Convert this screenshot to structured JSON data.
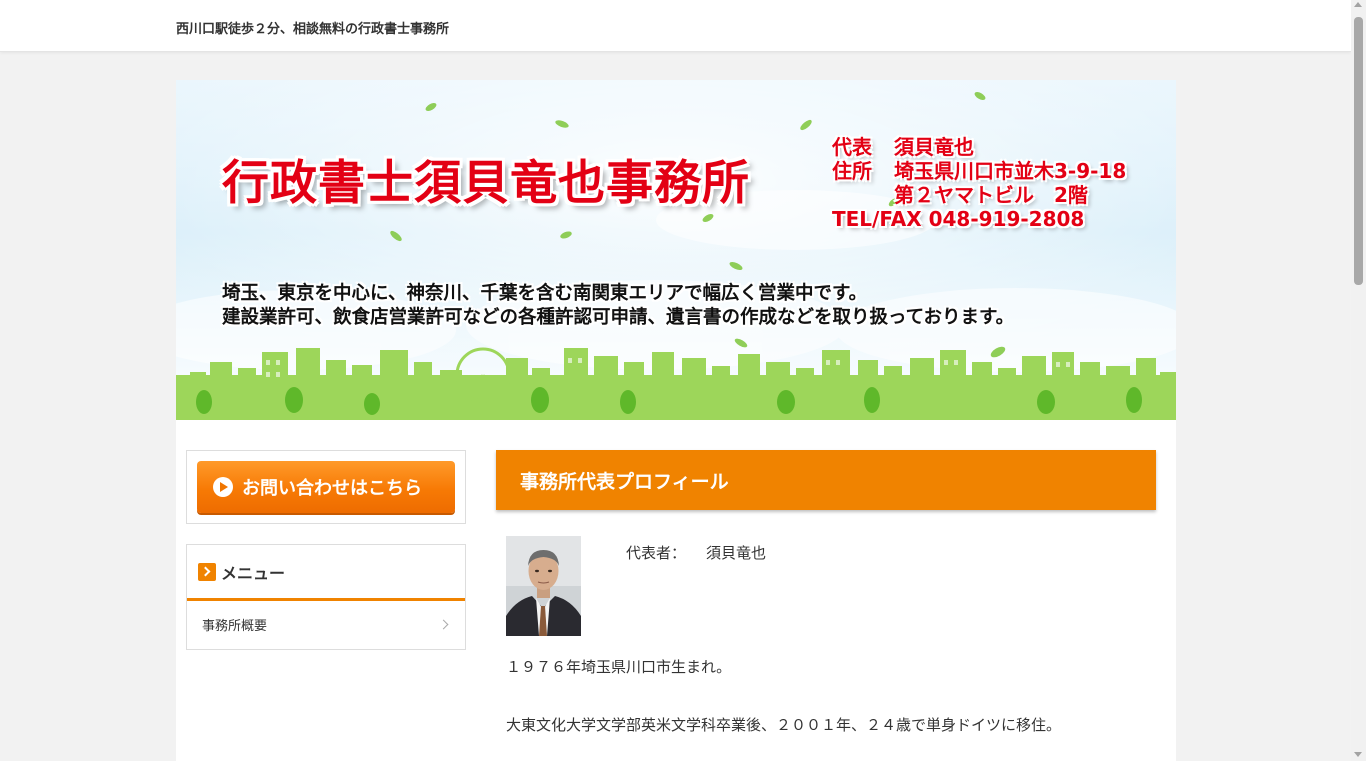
{
  "header": {
    "tagline": "西川口駅徒歩２分、相談無料の行政書士事務所"
  },
  "banner": {
    "title": "行政書士須貝竜也事務所",
    "representative_label": "代表",
    "representative_name": "須貝竜也",
    "address_label": "住所",
    "address_line1": "埼玉県川口市並木3-9-18",
    "address_line2": "第２ヤマトビル　2階",
    "tel_fax": "TEL/FAX 048-919-2808",
    "description_line1": "埼玉、東京を中心に、神奈川、千葉を含む南関東エリアで幅広く営業中です。",
    "description_line2": "建設業許可、飲食店営業許可などの各種許認可申請、遺言書の作成などを取り扱っております。"
  },
  "sidebar": {
    "contact_button": "お問い合わせはこちら",
    "menu_title": "メニュー",
    "menu_items": [
      {
        "label": "事務所概要"
      }
    ]
  },
  "main": {
    "section_title": "事務所代表プロフィール",
    "rep_label": "代表者：",
    "rep_name": "須貝竜也",
    "bio_paragraphs": [
      "１９７６年埼玉県川口市生まれ。",
      "大東文化大学文学部英米文学科卒業後、２００１年、２４歳で単身ドイツに移住。"
    ]
  },
  "colors": {
    "accent": "#f08300",
    "banner_red": "#e30014",
    "button_orange": "#f77a05"
  },
  "icons": [
    "play-circle-icon",
    "chevron-right-icon",
    "menu-chevron-icon"
  ]
}
